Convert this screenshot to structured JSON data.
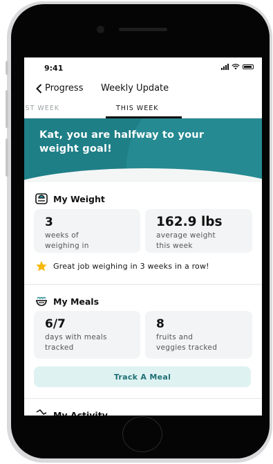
{
  "status_bar": {
    "time": "9:41",
    "signal_icon": "cellular-signal-icon",
    "wifi_icon": "wifi-icon",
    "battery_icon": "battery-icon"
  },
  "nav": {
    "back_label": "Progress",
    "title": "Weekly Update"
  },
  "tabs": [
    {
      "label": "LAST WEEK",
      "visible_text": "AST WEEK",
      "active": false
    },
    {
      "label": "THIS WEEK",
      "active": true
    }
  ],
  "hero": {
    "message": "Kat, you are halfway to your weight goal!"
  },
  "weight": {
    "title": "My Weight",
    "icon": "scale-icon",
    "cards": [
      {
        "value": "3",
        "label_line1": "weeks of",
        "label_line2": "weighing in"
      },
      {
        "value": "162.9 lbs",
        "label_line1": "average weight",
        "label_line2": "this week"
      }
    ],
    "achievement": "Great job weighing in 3 weeks in a row!",
    "achievement_icon": "star-icon"
  },
  "meals": {
    "title": "My Meals",
    "icon": "bowl-icon",
    "cards": [
      {
        "value": "6/7",
        "label_line1": "days with meals",
        "label_line2": "tracked"
      },
      {
        "value": "8",
        "label_line1": "fruits and",
        "label_line2": "veggies tracked"
      }
    ],
    "button_label": "Track A Meal"
  },
  "activity": {
    "title": "My Activity",
    "icon": "activity-icon"
  },
  "colors": {
    "accent": "#1f7f87",
    "button_bg": "#dff2f2",
    "button_text": "#1e6f75",
    "star": "#f5b90f"
  }
}
